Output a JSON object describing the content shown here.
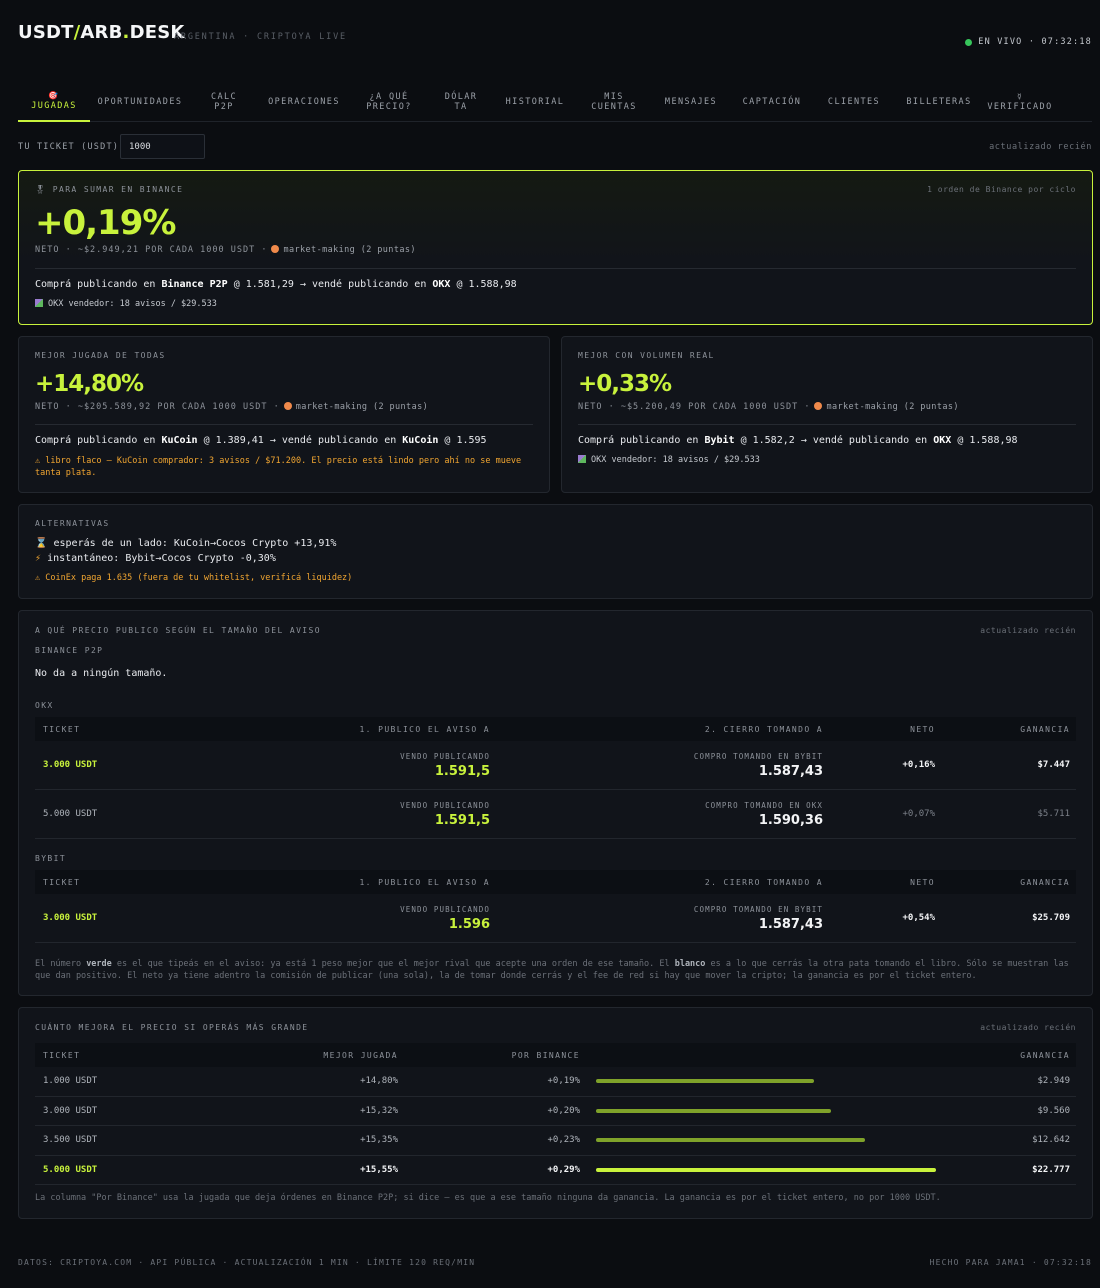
{
  "header": {
    "logo_a": "USDT",
    "logo_b": "ARB",
    "logo_c": "DESK",
    "subtitle": "ARGENTINA · CRIPTOYA LIVE",
    "live": "EN VIVO · 07:32:18"
  },
  "nav": [
    {
      "icon": "🎯",
      "label": "JUGADAS"
    },
    {
      "label": "OPORTUNIDADES"
    },
    {
      "label": "CALC",
      "label2": "P2P"
    },
    {
      "label": "OPERACIONES"
    },
    {
      "label": "¿A QUÉ",
      "label2": "PRECIO?"
    },
    {
      "label": "DÓLAR",
      "label2": "TA"
    },
    {
      "label": "HISTORIAL"
    },
    {
      "label": "MIS",
      "label2": "CUENTAS"
    },
    {
      "label": "MENSAJES"
    },
    {
      "label": "CAPTACIÓN"
    },
    {
      "label": "CLIENTES"
    },
    {
      "label": "BILLETERAS"
    },
    {
      "icon": "☿",
      "label": "VERIFICADO"
    }
  ],
  "ticket": {
    "label": "TU TICKET (USDT)",
    "value": "1000",
    "updated": "actualizado recién"
  },
  "hero": {
    "label": "🎖 PARA SUMAR EN BINANCE",
    "right": "1 orden de Binance por ciclo",
    "pct": "+0,19%",
    "neto": "NETO · ~$2.949,21 POR CADA 1000 USDT ·",
    "mm": "market-making (2 puntas)",
    "a1": "Comprá publicando en ",
    "b1": "Binance P2P",
    "a2": " @ 1.581,29 → vendé publicando en ",
    "b2": "OKX",
    "a3": " @ 1.588,98",
    "vendor": "OKX vendedor: 18 avisos / $29.533"
  },
  "best": {
    "label": "MEJOR JUGADA DE TODAS",
    "pct": "+14,80%",
    "neto": "NETO · ~$205.589,92 POR CADA 1000 USDT ·",
    "mm": "market-making (2 puntas)",
    "a1": "Comprá publicando en ",
    "b1": "KuCoin",
    "a2": " @ 1.389,41 → vendé publicando en ",
    "b2": "KuCoin",
    "a3": " @ 1.595",
    "warn1": "libro flaco — KuCoin comprador: 3 avisos / $71.200. El precio está lindo pero ahí no se mueve",
    "warn2": "tanta plata."
  },
  "volume": {
    "label": "MEJOR CON VOLUMEN REAL",
    "pct": "+0,33%",
    "neto": "NETO · ~$5.200,49 POR CADA 1000 USDT ·",
    "mm": "market-making (2 puntas)",
    "a1": "Comprá publicando en ",
    "b1": "Bybit",
    "a2": " @ 1.582,2 → vendé publicando en ",
    "b2": "OKX",
    "a3": " @ 1.588,98",
    "vendor": "OKX vendedor: 18 avisos / $29.533"
  },
  "alternatives": {
    "label": "ALTERNATIVAS",
    "l1": "esperás de un lado: KuCoin→Cocos Crypto +13,91%",
    "l2": "instantáneo: Bybit→Cocos Crypto -0,30%",
    "l3": "CoinEx paga 1.635 (fuera de tu whitelist, verificá liquidez)"
  },
  "price": {
    "label": "A QUÉ PRECIO PUBLICO SEGÚN EL TAMAÑO DEL AVISO",
    "updated": "actualizado recién",
    "binance_label": "BINANCE P2P",
    "binance_text": "No da a ningún tamaño.",
    "headers": [
      "TICKET",
      "1. PUBLICO EL AVISO A",
      "2. CIERRO TOMANDO A",
      "NETO",
      "GANANCIA"
    ],
    "okx_label": "OKX",
    "okx_rows": [
      {
        "ticket": "3.000 USDT",
        "sub1": "VENDO PUBLICANDO",
        "p1": "1.591,5",
        "sub2": "COMPRO TOMANDO EN BYBIT",
        "p2": "1.587,43",
        "neto": "+0,16%",
        "gain": "$7.447",
        "hl": true
      },
      {
        "ticket": "5.000 USDT",
        "sub1": "VENDO PUBLICANDO",
        "p1": "1.591,5",
        "sub2": "COMPRO TOMANDO EN OKX",
        "p2": "1.590,36",
        "neto": "+0,07%",
        "gain": "$5.711",
        "hl": false
      }
    ],
    "bybit_label": "BYBIT",
    "bybit_rows": [
      {
        "ticket": "3.000 USDT",
        "sub1": "VENDO PUBLICANDO",
        "p1": "1.596",
        "sub2": "COMPRO TOMANDO EN BYBIT",
        "p2": "1.587,43",
        "neto": "+0,54%",
        "gain": "$25.709",
        "hl": true
      }
    ],
    "note_a": "El número ",
    "note_b": "verde",
    "note_c": " es el que tipeás en el aviso: ya está 1 peso mejor que el mejor rival que acepte una orden de ese tamaño. El ",
    "note_d": "blanco",
    "note_e": " es a lo que cerrás la otra pata tomando el libro. Sólo se muestran las",
    "note_f": "que dan positivo. El neto ya tiene adentro la comisión de publicar (una sola), la de tomar donde cerrás y el fee de red si hay que mover la cripto; la ganancia es por el ticket entero."
  },
  "scale": {
    "label": "CUÁNTO MEJORA EL PRECIO SI OPERÁS MÁS GRANDE",
    "updated": "actualizado recién",
    "headers": [
      "TICKET",
      "MEJOR JUGADA",
      "POR BINANCE",
      "GANANCIA"
    ],
    "rows": [
      {
        "ticket": "1.000 USDT",
        "best": "+14,80%",
        "binance": "+0,19%",
        "bar": 0.64,
        "gain": "$2.949",
        "hl": false
      },
      {
        "ticket": "3.000 USDT",
        "best": "+15,32%",
        "binance": "+0,20%",
        "bar": 0.69,
        "gain": "$9.560",
        "hl": false
      },
      {
        "ticket": "3.500 USDT",
        "best": "+15,35%",
        "binance": "+0,23%",
        "bar": 0.79,
        "gain": "$12.642",
        "hl": false
      },
      {
        "ticket": "5.000 USDT",
        "best": "+15,55%",
        "binance": "+0,29%",
        "bar": 1.0,
        "gain": "$22.777",
        "hl": true
      }
    ],
    "note": "La columna \"Por Binance\" usa la jugada que deja órdenes en Binance P2P; si dice — es que a ese tamaño ninguna da ganancia. La ganancia es por el ticket entero, no por 1000 USDT."
  },
  "footer": {
    "left": "DATOS: CRIPTOYA.COM · API PÚBLICA · ACTUALIZACIÓN 1 MIN · LÍMITE 120 REQ/MIN",
    "right": "HECHO PARA JAMA1 · 07:32:18"
  },
  "colors": {
    "accent": "#c8f23c",
    "warning": "#f0a531",
    "live": "#37c55b",
    "background": "#0b0d11"
  }
}
